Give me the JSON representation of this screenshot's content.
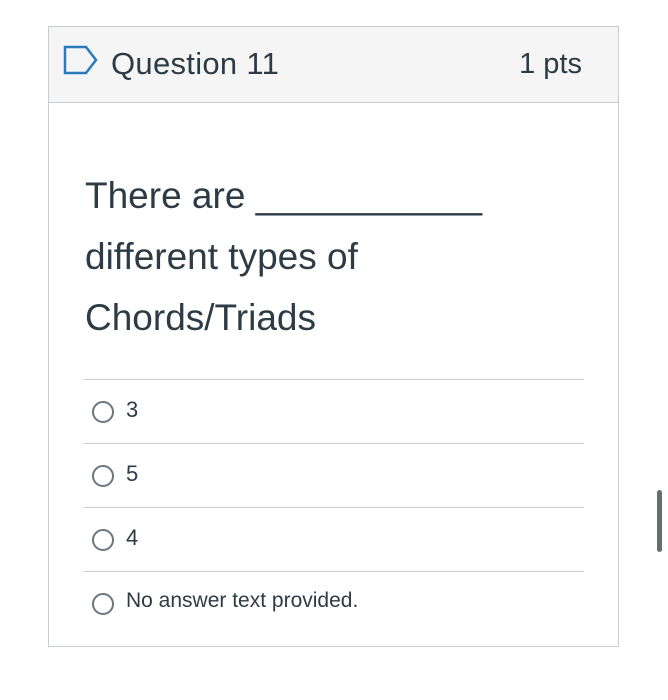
{
  "question": {
    "title": "Question 11",
    "points": "1 pts",
    "text": "There are ___________ different types of Chords/Triads",
    "flag_icon": "flag-outline-icon"
  },
  "answers": [
    {
      "label": "3",
      "selected": false
    },
    {
      "label": "5",
      "selected": false
    },
    {
      "label": "4",
      "selected": false
    },
    {
      "label": "No answer text provided.",
      "selected": false
    }
  ],
  "colors": {
    "header_bg": "#f5f5f5",
    "border": "#c7cdd1",
    "text": "#2d3b45",
    "flag": "#2b7abc"
  }
}
